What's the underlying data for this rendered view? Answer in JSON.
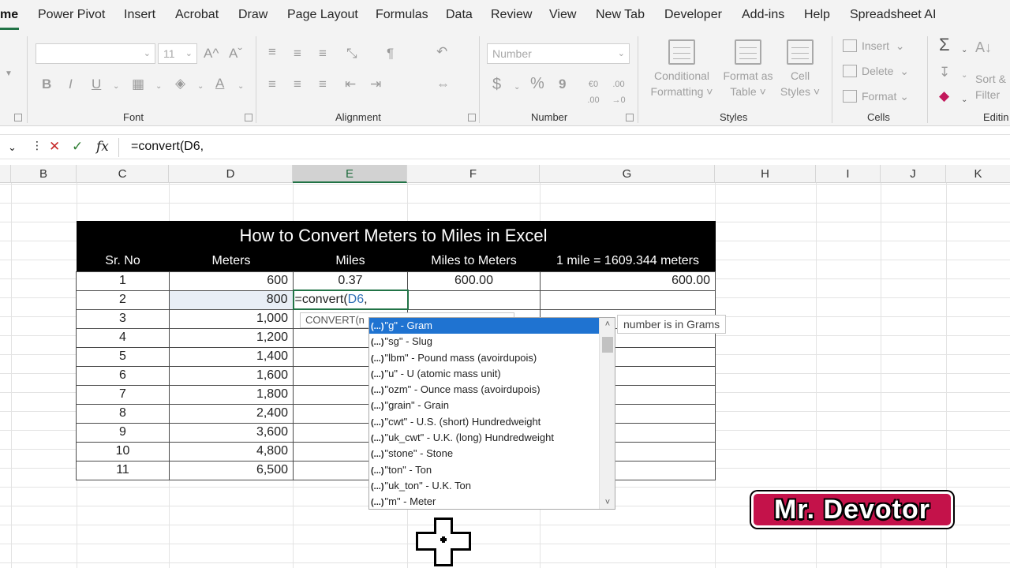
{
  "ribbon_tabs": [
    {
      "label": "me",
      "active": true
    },
    {
      "label": "Power Pivot"
    },
    {
      "label": "Insert"
    },
    {
      "label": "Acrobat"
    },
    {
      "label": "Draw"
    },
    {
      "label": "Page Layout"
    },
    {
      "label": "Formulas"
    },
    {
      "label": "Data"
    },
    {
      "label": "Review"
    },
    {
      "label": "View"
    },
    {
      "label": "New Tab"
    },
    {
      "label": "Developer"
    },
    {
      "label": "Add-ins"
    },
    {
      "label": "Help"
    },
    {
      "label": "Spreadsheet AI"
    }
  ],
  "ribbon": {
    "font": {
      "group_label": "Font",
      "size_value": "11",
      "grow_label": "A^",
      "shrink_label": "Aˇ",
      "bold": "B",
      "italic": "I",
      "underline": "U",
      "font_color": "A"
    },
    "alignment": {
      "group_label": "Alignment"
    },
    "number": {
      "group_label": "Number",
      "format_placeholder": "Number",
      "currency": "$",
      "percent": "%",
      "comma": "9",
      "inc_dec": "€0 .00",
      "dec_dec": ".00 →0"
    },
    "styles": {
      "group_label": "Styles",
      "conditional_formatting": [
        "Conditional",
        "Formatting ˅"
      ],
      "format_as_table": [
        "Format as",
        "Table ˅"
      ],
      "cell_styles": [
        "Cell",
        "Styles ˅"
      ]
    },
    "cells": {
      "group_label": "Cells",
      "insert": "Insert",
      "delete": "Delete",
      "format": "Format"
    },
    "editing": {
      "group_label": "Editin",
      "sort_filter": [
        "Sort &",
        "Filter"
      ],
      "autosum": "Σ"
    }
  },
  "formula_bar": {
    "cancel_icon": "✕",
    "enter_icon": "✓",
    "fx": "fx",
    "formula": "=convert(D6,"
  },
  "columns": [
    "B",
    "C",
    "D",
    "E",
    "F",
    "G",
    "H",
    "I",
    "J",
    "K"
  ],
  "selected_column": "E",
  "table": {
    "title": "How to Convert Meters to Miles in Excel",
    "headers": [
      "Sr. No",
      "Meters",
      "Miles",
      "Miles to Meters",
      "1 mile = 1609.344 meters"
    ],
    "rows": [
      {
        "sr": "1",
        "meters": "600",
        "miles": "0.37",
        "m2m": "600.00",
        "conv": "600.00"
      },
      {
        "sr": "2",
        "meters": "800",
        "miles": "",
        "m2m": "",
        "conv": ""
      },
      {
        "sr": "3",
        "meters": "1,000",
        "miles": "",
        "m2m": "",
        "conv": ""
      },
      {
        "sr": "4",
        "meters": "1,200",
        "miles": "",
        "m2m": "",
        "conv": ""
      },
      {
        "sr": "5",
        "meters": "1,400",
        "miles": "",
        "m2m": "",
        "conv": ""
      },
      {
        "sr": "6",
        "meters": "1,600",
        "miles": "",
        "m2m": "",
        "conv": ""
      },
      {
        "sr": "7",
        "meters": "1,800",
        "miles": "",
        "m2m": "",
        "conv": ""
      },
      {
        "sr": "8",
        "meters": "2,400",
        "miles": "",
        "m2m": "",
        "conv": ""
      },
      {
        "sr": "9",
        "meters": "3,600",
        "miles": "",
        "m2m": "",
        "conv": ""
      },
      {
        "sr": "10",
        "meters": "4,800",
        "miles": "",
        "m2m": "",
        "conv": ""
      },
      {
        "sr": "11",
        "meters": "6,500",
        "miles": "",
        "m2m": "",
        "conv": ""
      }
    ],
    "editing_cell": {
      "prefix": "=convert(",
      "ref": "D6",
      "suffix": ","
    }
  },
  "autocomplete": {
    "tooltip": "CONVERT(n",
    "tooltip_hint": "number is in Grams",
    "item_icon": "(...)",
    "items": [
      "\"g\" - Gram",
      "\"sg\" - Slug",
      "\"lbm\" - Pound mass (avoirdupois)",
      "\"u\" - U (atomic mass unit)",
      "\"ozm\" - Ounce mass (avoirdupois)",
      "\"grain\" - Grain",
      "\"cwt\" - U.S. (short) Hundredweight",
      "\"uk_cwt\" - U.K. (long) Hundredweight",
      "\"stone\" - Stone",
      "\"ton\" - Ton",
      "\"uk_ton\" - U.K. Ton",
      "\"m\" - Meter"
    ],
    "highlighted_index": 0,
    "scroll_up": "˄",
    "scroll_down": "˅"
  },
  "watermark": {
    "text": "Mr. Devotor"
  },
  "colors": {
    "accent": "#217346",
    "highlight": "#1f73d1",
    "table_header": "#000000",
    "watermark": "#c4124a"
  }
}
